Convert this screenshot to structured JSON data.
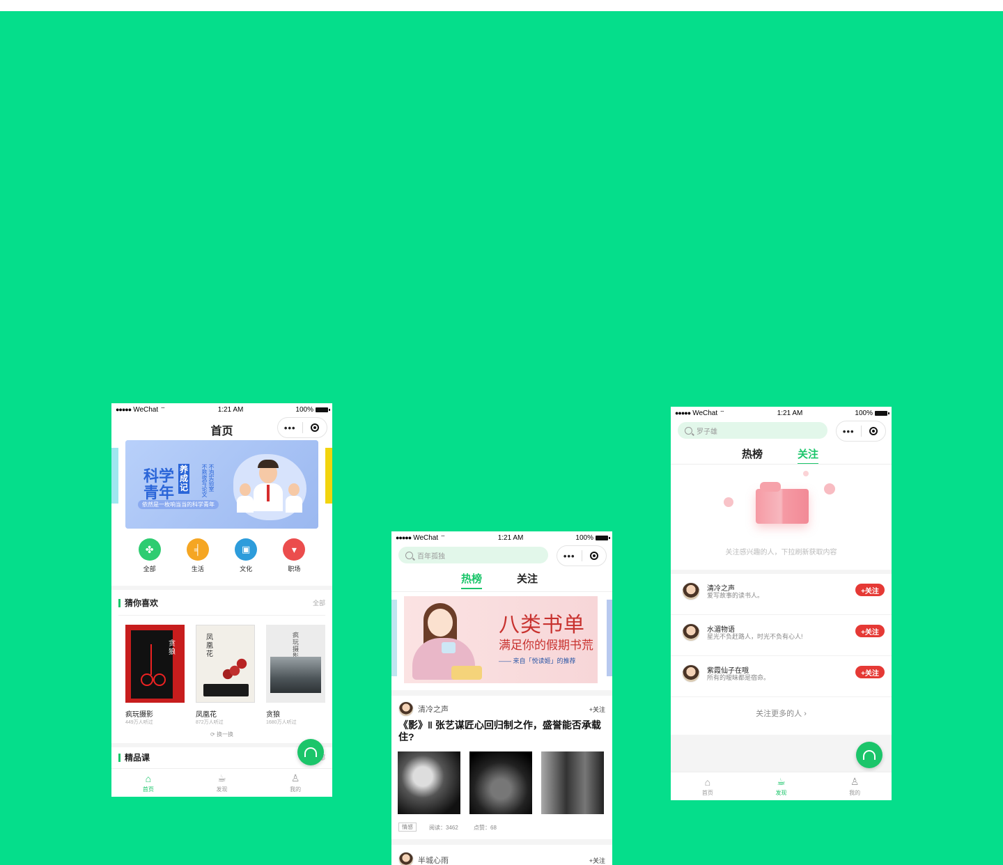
{
  "status": {
    "carrier": "WeChat",
    "time": "1:21 AM",
    "battery": "100%"
  },
  "phone1": {
    "title": "首页",
    "banner": {
      "title_line1": "科学",
      "title_line2": "青年",
      "tag_chars": "养成记",
      "vertical_text": "不泡实验室 不熬夜写论文",
      "subtitle": "依然是一枚响当当的科学青年"
    },
    "categories": [
      {
        "label": "全部",
        "color": "#2ecc71",
        "icon": "clover-icon"
      },
      {
        "label": "生活",
        "color": "#f5a623",
        "icon": "chair-icon"
      },
      {
        "label": "文化",
        "color": "#2d9cdb",
        "icon": "book-icon"
      },
      {
        "label": "职场",
        "color": "#eb4d4d",
        "icon": "tie-icon"
      }
    ],
    "section_title": "猜你喜欢",
    "section_more": "全部",
    "books": [
      {
        "title": "疯玩摄影",
        "listens": "449万人听过",
        "cover_text": "贪狼"
      },
      {
        "title": "凤凰花",
        "listens": "872万人听过",
        "cover_text": "凤凰花"
      },
      {
        "title": "贪狼",
        "listens": "1680万人听过",
        "cover_text": "疯玩摄影"
      }
    ],
    "refresh": "换一换",
    "section2_title": "精品课",
    "section2_more": "部",
    "nav": [
      "首页",
      "发现",
      "我的"
    ]
  },
  "phone2": {
    "search_placeholder": "百年孤独",
    "tabs": [
      "热榜",
      "关注"
    ],
    "banner": {
      "headline": "八类书单",
      "subline": "满足你的假期书荒",
      "source": "—— 来自「悦读姬」的推荐"
    },
    "post1": {
      "author": "清冷之声",
      "follow": "+关注",
      "title": "《影》‖ 张艺谋匠心回归制之作，盛誉能否承载住?",
      "tag": "情感",
      "reads": "阅读：3462",
      "likes": "点赞：68"
    },
    "post2": {
      "author": "半城心雨",
      "follow": "+关注"
    }
  },
  "phone3": {
    "search_placeholder": "罗子雄",
    "tabs": [
      "热榜",
      "关注"
    ],
    "empty_hint": "关注感兴趣的人，下拉刷新获取内容",
    "people": [
      {
        "name": "清冷之声",
        "desc": "爱写故事的读书人。",
        "btn": "+关注"
      },
      {
        "name": "水湄物语",
        "desc": "星光不负赶路人，时光不负有心人!",
        "btn": "+关注"
      },
      {
        "name": "紫霞仙子在哦",
        "desc": "所有的暧昧都是宿命。",
        "btn": "+关注"
      }
    ],
    "more": "关注更多的人",
    "nav": [
      "首页",
      "发现",
      "我的"
    ]
  },
  "colors": {
    "background": "#05DE8B",
    "accent": "#1BC56A",
    "follow_red": "#e53935"
  }
}
